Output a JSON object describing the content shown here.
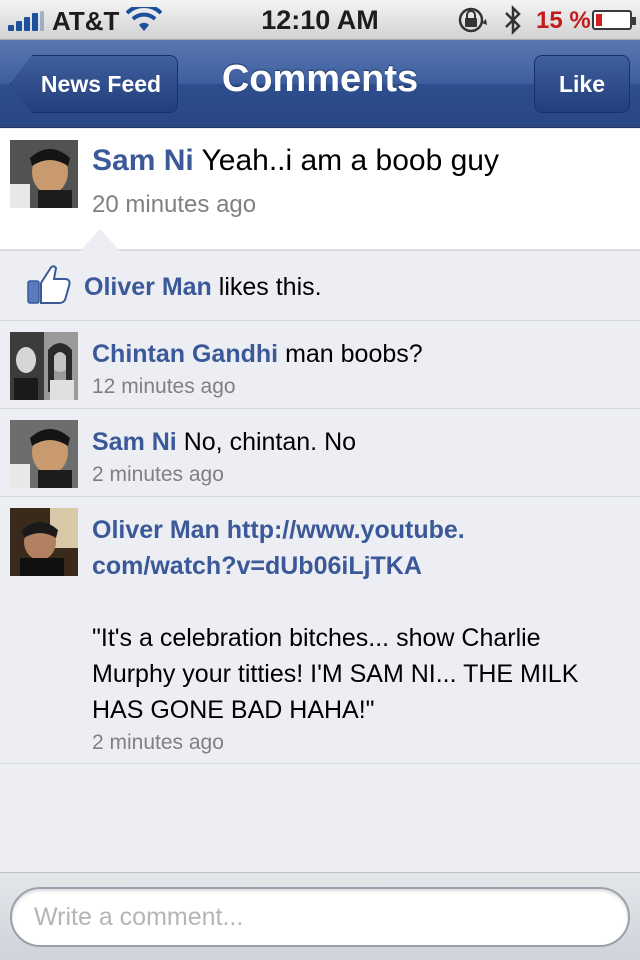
{
  "status_bar": {
    "carrier": "AT&T",
    "time": "12:10 AM",
    "battery_percent": "15 %",
    "battery_level": 0.15,
    "icons": [
      "signal-icon",
      "wifi-icon",
      "rotation-lock-icon",
      "bluetooth-icon",
      "battery-icon"
    ]
  },
  "nav": {
    "back_label": "News Feed",
    "title": "Comments",
    "like_label": "Like"
  },
  "post": {
    "author": "Sam Ni",
    "text": "Yeah..i am a boob guy",
    "time": "20 minutes ago"
  },
  "likes": {
    "name": "Oliver Man",
    "suffix": "likes this."
  },
  "comments": [
    {
      "author": "Chintan Gandhi",
      "text": "man boobs?",
      "time": "12 minutes ago"
    },
    {
      "author": "Sam Ni",
      "text": "No, chintan. No",
      "time": "2 minutes ago"
    },
    {
      "author": "Oliver Man",
      "link_line1": "http://www.youtube.",
      "link_line2": "com/watch?v=dUb06iLjTKA",
      "text": "\"It's a celebration bitches... show Charlie Murphy your titties! I'M SAM NI... THE MILK HAS GONE BAD HAHA!\"",
      "time": "2 minutes ago"
    }
  ],
  "compose": {
    "placeholder": "Write a comment..."
  },
  "colors": {
    "link_blue": "#3b5998",
    "nav_blue": "#3d5e9f",
    "battery_red": "#d22020"
  }
}
